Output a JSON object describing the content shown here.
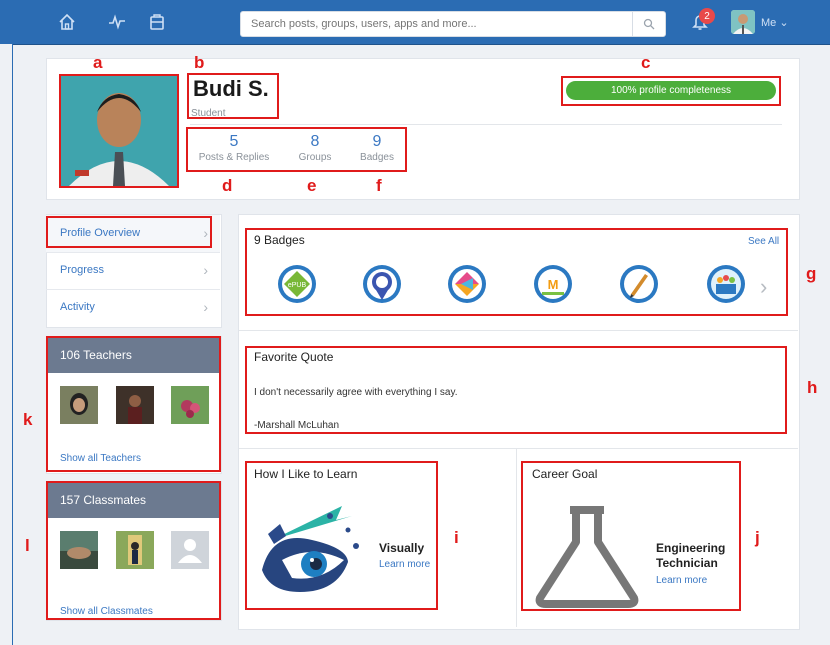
{
  "search": {
    "placeholder": "Search posts, groups, users, apps and more..."
  },
  "notifications": {
    "count": "2"
  },
  "me_label": "Me",
  "profile": {
    "name": "Budi S.",
    "role": "Student",
    "completeness": "100% profile completeness",
    "stats": [
      {
        "value": "5",
        "label": "Posts & Replies"
      },
      {
        "value": "8",
        "label": "Groups"
      },
      {
        "value": "9",
        "label": "Badges"
      }
    ]
  },
  "annotations": {
    "a": "a",
    "b": "b",
    "c": "c",
    "d": "d",
    "e": "e",
    "f": "f",
    "g": "g",
    "h": "h",
    "i": "i",
    "j": "j",
    "k": "k",
    "l": "l"
  },
  "side_nav": [
    {
      "label": "Profile Overview"
    },
    {
      "label": "Progress"
    },
    {
      "label": "Activity"
    }
  ],
  "teachers": {
    "title": "106 Teachers",
    "show_all": "Show all Teachers"
  },
  "classmates": {
    "title": "157 Classmates",
    "show_all": "Show all Classmates"
  },
  "badges": {
    "title": "9 Badges",
    "see_all": "See All"
  },
  "quote": {
    "title": "Favorite Quote",
    "text": "I don't necessarily agree with everything I say.",
    "author": "-Marshall McLuhan"
  },
  "learn": {
    "title": "How I Like to Learn",
    "value": "Visually",
    "more": "Learn more"
  },
  "career": {
    "title": "Career Goal",
    "value_line1": "Engineering",
    "value_line2": "Technician",
    "more": "Learn more"
  },
  "colors": {
    "topbar": "#2b6cb3",
    "accent": "#3b78c3",
    "progress": "#4cae3b",
    "annotation": "#e01b1b",
    "panel_head": "#6c7a90"
  }
}
